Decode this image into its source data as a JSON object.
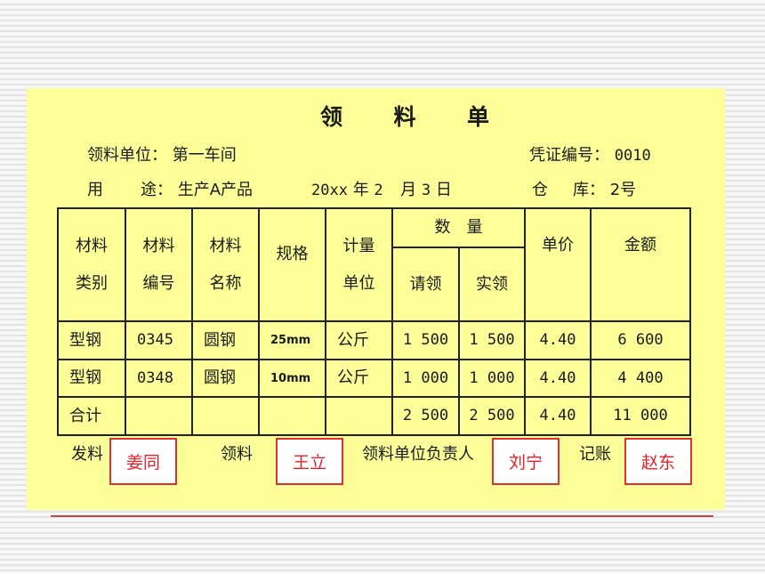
{
  "form": {
    "title_chars": [
      "领",
      "料",
      "单"
    ],
    "requisition_unit_label": "领料单位：",
    "requisition_unit_value": "第一车间",
    "voucher_no_label": "凭证编号：",
    "voucher_no_value": "0010",
    "purpose_label_1": "用",
    "purpose_label_2": "途：",
    "purpose_value": "生产A产品",
    "date_year": "20xx",
    "date_year_unit": "年",
    "date_month": "2",
    "date_month_unit": "月",
    "date_day": "3",
    "date_day_unit": "日",
    "warehouse_label_1": "仓",
    "warehouse_label_2": "库：",
    "warehouse_value": "2号"
  },
  "table": {
    "headers": {
      "category": [
        "材料",
        "类别"
      ],
      "code": [
        "材料",
        "编号"
      ],
      "name": [
        "材料",
        "名称"
      ],
      "spec": "规格",
      "unit": [
        "计量",
        "单位"
      ],
      "quantity": "数　量",
      "requested": "请领",
      "actual": "实领",
      "unit_price": "单价",
      "amount": "金额"
    },
    "rows": [
      {
        "category": "型钢",
        "code": "0345",
        "name": "圆钢",
        "spec": "25mm",
        "unit": "公斤",
        "requested": "1 500",
        "actual": "1 500",
        "unit_price": "4.40",
        "amount": "6 600"
      },
      {
        "category": "型钢",
        "code": "0348",
        "name": "圆钢",
        "spec": "10mm",
        "unit": "公斤",
        "requested": "1 000",
        "actual": "1 000",
        "unit_price": "4.40",
        "amount": "4 400"
      }
    ],
    "total": {
      "label": "合计",
      "requested": "2 500",
      "actual": "2 500",
      "unit_price": "4.40",
      "amount": "11 000"
    }
  },
  "signatures": [
    {
      "label": "发料",
      "name": "姜同"
    },
    {
      "label": "领料",
      "name": "王立"
    },
    {
      "label": "领料单位负责人",
      "name": "刘宁"
    },
    {
      "label": "记账",
      "name": "赵东"
    }
  ],
  "colors": {
    "panel_background": "#ffff99",
    "signature_red": "#e8202a",
    "rule_red": "#c04848"
  }
}
